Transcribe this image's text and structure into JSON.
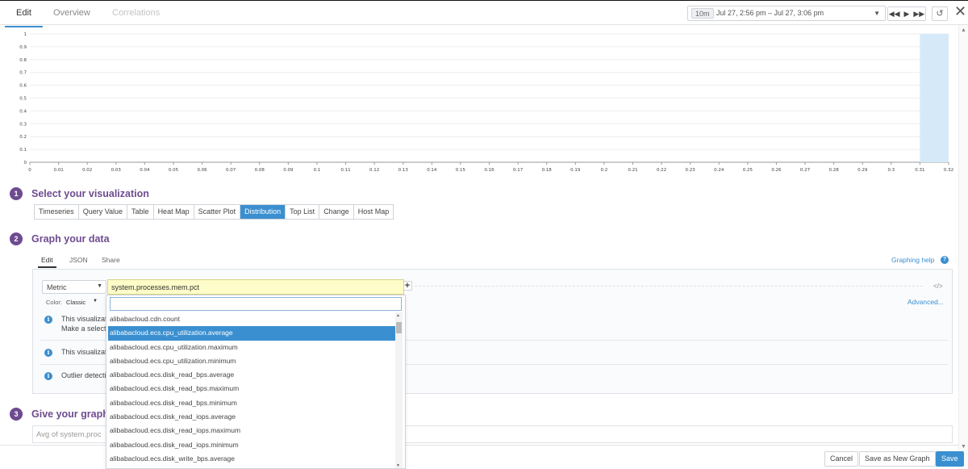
{
  "top_tabs": {
    "edit": "Edit",
    "overview": "Overview",
    "correlations": "Correlations"
  },
  "timeframe": {
    "preset": "10m",
    "range": "Jul 27, 2:56 pm – Jul 27, 3:06 pm"
  },
  "toolbar": {
    "rewind": "◀◀",
    "play": "▶",
    "forward": "▶▶",
    "reset": "↺",
    "close": "✕"
  },
  "chart_data": {
    "type": "bar",
    "x_ticks": [
      "0",
      "0.01",
      "0.02",
      "0.03",
      "0.04",
      "0.05",
      "0.06",
      "0.07",
      "0.08",
      "0.09",
      "0.1",
      "0.11",
      "0.12",
      "0.13",
      "0.14",
      "0.15",
      "0.16",
      "0.17",
      "0.18",
      "0.19",
      "0.2",
      "0.21",
      "0.22",
      "0.23",
      "0.24",
      "0.25",
      "0.26",
      "0.27",
      "0.28",
      "0.29",
      "0.3",
      "0.31",
      "0.32"
    ],
    "y_ticks": [
      "0",
      "0.1",
      "0.2",
      "0.3",
      "0.4",
      "0.5",
      "0.6",
      "0.7",
      "0.8",
      "0.9",
      "1"
    ],
    "xlim": [
      0,
      0.32
    ],
    "ylim": [
      0,
      1
    ],
    "bars": [
      {
        "x0": 0.31,
        "x1": 0.32,
        "value": 1
      }
    ],
    "bar_color": "#d6e9f8",
    "grid": true
  },
  "step1": {
    "number": "1",
    "title": "Select your visualization"
  },
  "visualizations": [
    "Timeseries",
    "Query Value",
    "Table",
    "Heat Map",
    "Scatter Plot",
    "Distribution",
    "Top List",
    "Change",
    "Host Map"
  ],
  "active_visualization": "Distribution",
  "step2": {
    "number": "2",
    "title": "Graph your data"
  },
  "editor_tabs": {
    "edit": "Edit",
    "json": "JSON",
    "share": "Share"
  },
  "graphing_help": "Graphing help",
  "help_icon": "?",
  "query": {
    "type_select": "Metric",
    "metric_value": "system.processes.mem.pct",
    "search_value": "",
    "add_icon": "+",
    "code_icon": "</>",
    "advanced_link": "Advanced...",
    "color_label": "Color:",
    "color_value": "Classic"
  },
  "info_messages": [
    {
      "icon": "i",
      "line1": "This visualization",
      "line2": "Make a selection"
    },
    {
      "icon": "i",
      "line1": "This visualization"
    },
    {
      "icon": "i",
      "line1": "Outlier detection"
    }
  ],
  "metric_options": [
    "alibabacloud.cdn.count",
    "alibabacloud.ecs.cpu_utilization.average",
    "alibabacloud.ecs.cpu_utilization.maximum",
    "alibabacloud.ecs.cpu_utilization.minimum",
    "alibabacloud.ecs.disk_read_bps.average",
    "alibabacloud.ecs.disk_read_bps.maximum",
    "alibabacloud.ecs.disk_read_bps.minimum",
    "alibabacloud.ecs.disk_read_iops.average",
    "alibabacloud.ecs.disk_read_iops.maximum",
    "alibabacloud.ecs.disk_read_iops.minimum",
    "alibabacloud.ecs.disk_write_bps.average"
  ],
  "highlighted_option": "alibabacloud.ecs.cpu_utilization.average",
  "step3": {
    "number": "3",
    "title": "Give your graph"
  },
  "title_input": {
    "value": "Avg of system.proc"
  },
  "footer": {
    "cancel": "Cancel",
    "save_new": "Save as New Graph",
    "save": "Save"
  }
}
